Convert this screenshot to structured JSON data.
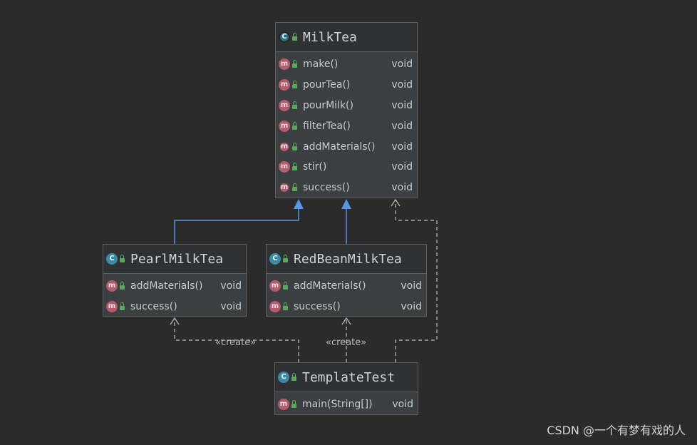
{
  "classes": {
    "milktea": {
      "name": "MilkTea",
      "icon": "abstract-class-icon",
      "methods": [
        {
          "name": "make()",
          "type": "void",
          "icon": "method-icon"
        },
        {
          "name": "pourTea()",
          "type": "void",
          "icon": "method-icon"
        },
        {
          "name": "pourMilk()",
          "type": "void",
          "icon": "method-icon"
        },
        {
          "name": "filterTea()",
          "type": "void",
          "icon": "method-icon"
        },
        {
          "name": "addMaterials()",
          "type": "void",
          "icon": "abstract-method-icon"
        },
        {
          "name": "stir()",
          "type": "void",
          "icon": "method-icon"
        },
        {
          "name": "success()",
          "type": "void",
          "icon": "abstract-method-icon"
        }
      ]
    },
    "pearl": {
      "name": "PearlMilkTea",
      "icon": "class-icon",
      "methods": [
        {
          "name": "addMaterials()",
          "type": "void",
          "icon": "method-icon"
        },
        {
          "name": "success()",
          "type": "void",
          "icon": "method-icon"
        }
      ]
    },
    "redbean": {
      "name": "RedBeanMilkTea",
      "icon": "class-icon",
      "methods": [
        {
          "name": "addMaterials()",
          "type": "void",
          "icon": "method-icon"
        },
        {
          "name": "success()",
          "type": "void",
          "icon": "method-icon"
        }
      ]
    },
    "templatetest": {
      "name": "TemplateTest",
      "icon": "class-icon",
      "methods": [
        {
          "name": "main(String[])",
          "type": "void",
          "icon": "static-method-icon"
        }
      ]
    }
  },
  "relations": {
    "create_left": "«create»",
    "create_right": "«create»"
  },
  "colors": {
    "inheritance": "#5894e6",
    "dependency": "#b9bcbe"
  },
  "watermark": "CSDN @一个有梦有戏的人"
}
